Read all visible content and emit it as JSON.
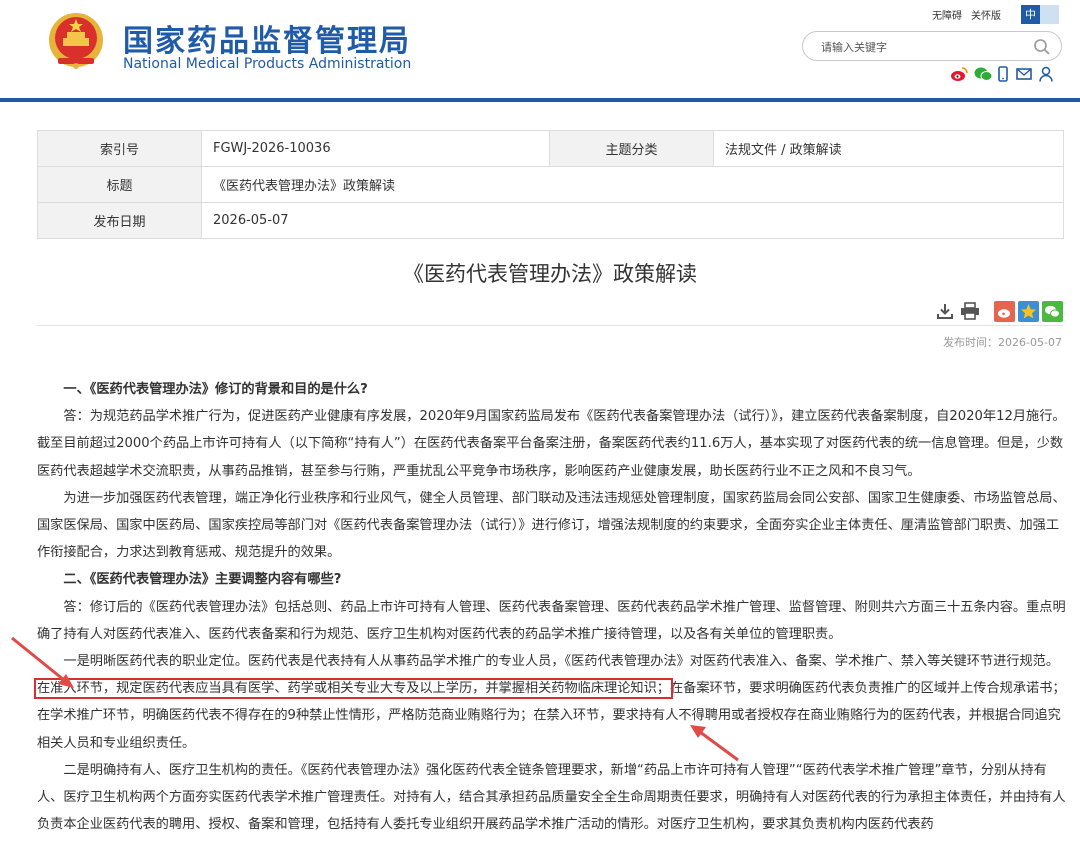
{
  "header": {
    "site_name_cn": "国家药品监督管理局",
    "site_name_en": "National Medical Products Administration",
    "accessibility": "无障碍",
    "care_mode": "关怀版",
    "lang_zh": "中",
    "lang_en": "",
    "search_placeholder": "请输入关键字",
    "social_icons": [
      "weibo-icon",
      "wechat-icon",
      "mobile-icon",
      "mail-icon",
      "user-icon"
    ]
  },
  "info_table": {
    "index_label": "索引号",
    "index_value": "FGWJ-2026-10036",
    "category_label": "主题分类",
    "category_value": "法规文件 / 政策解读",
    "title_label": "标题",
    "title_value": "《医药代表管理办法》政策解读",
    "date_label": "发布日期",
    "date_value": "2026-05-07"
  },
  "article": {
    "title": "《医药代表管理办法》政策解读",
    "publish_time": "发布时间：2026-05-07",
    "h1": "一、《医药代表管理办法》修订的背景和目的是什么?",
    "p1": "答：为规范药品学术推广行为，促进医药产业健康有序发展，2020年9月国家药监局发布《医药代表备案管理办法（试行）》，建立医药代表备案制度，自2020年12月施行。截至目前超过2000个药品上市许可持有人（以下简称“持有人”）在医药代表备案平台备案注册，备案医药代表约11.6万人，基本实现了对医药代表的统一信息管理。但是，少数医药代表超越学术交流职责，从事药品推销，甚至参与行贿，严重扰乱公平竞争市场秩序，影响医药产业健康发展，助长医药行业不正之风和不良习气。",
    "p2": "为进一步加强医药代表管理，端正净化行业秩序和行业风气，健全人员管理、部门联动及违法违规惩处管理制度，国家药监局会同公安部、国家卫生健康委、市场监管总局、国家医保局、国家中医药局、国家疾控局等部门对《医药代表备案管理办法（试行）》进行修订，增强法规制度的约束要求，全面夯实企业主体责任、厘清监管部门职责、加强工作衔接配合，力求达到教育惩戒、规范提升的效果。",
    "h2": "二、《医药代表管理办法》主要调整内容有哪些?",
    "p3": "答：修订后的《医药代表管理办法》包括总则、药品上市许可持有人管理、医药代表备案管理、医药代表药品学术推广管理、监督管理、附则共六方面三十五条内容。重点明确了持有人对医药代表准入、医药代表备案和行为规范、医疗卫生机构对医药代表的药品学术推广接待管理，以及各有关单位的管理职责。",
    "p4_a": "一是明晰医药代表的职业定位。医药代表是代表持有人从事药品学术推广的专业人员，《医药代表管理办法》对医药代表准入、备案、学术推广、禁入等关键环节进行规范。",
    "p4_highlight": "在准入环节，规定医药代表应当具有医学、药学或相关专业大专及以上学历，并掌握相关药物临床理论知识；",
    "p4_b": "在备案环节，要求明确医药代表负责推广的区域并上传合规承诺书；在学术推广环节，明确医药代表不得存在的9种禁止性情形，严格防范商业贿赂行为；在禁入环节，要求持有人不得聘用或者授权存在商业贿赂行为的医药代表，并根据合同追究相关人员和专业组织责任。",
    "p5": "二是明确持有人、医疗卫生机构的责任。《医药代表管理办法》强化医药代表全链条管理要求，新增“药品上市许可持有人管理”“医药代表学术推广管理”章节，分别从持有人、医疗卫生机构两个方面夯实医药代表学术推广管理责任。对持有人，结合其承担药品质量安全全生命周期责任要求，明确持有人对医药代表的行为承担主体责任，并由持有人负责本企业医药代表的聘用、授权、备案和管理，包括持有人委托专业组织开展药品学术推广活动的情形。对医疗卫生机构，要求其负责机构内医药代表药"
  },
  "colors": {
    "brand_blue": "#1f5ba6",
    "annotation_red": "#d9302c"
  }
}
